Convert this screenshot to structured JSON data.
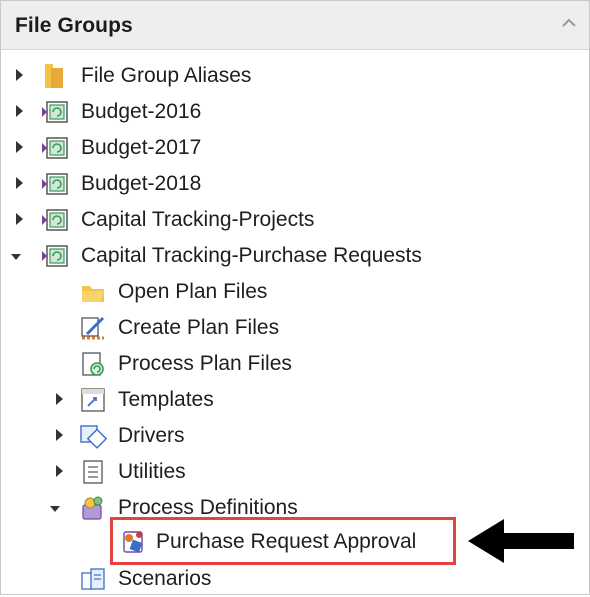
{
  "panel": {
    "title": "File Groups"
  },
  "tree": {
    "file_group_aliases": "File Group Aliases",
    "budget_2016": "Budget-2016",
    "budget_2017": "Budget-2017",
    "budget_2018": "Budget-2018",
    "capital_projects": "Capital Tracking-Projects",
    "capital_purchase": "Capital Tracking-Purchase Requests",
    "open_plan_files": "Open Plan Files",
    "create_plan_files": "Create Plan Files",
    "process_plan_files": "Process Plan Files",
    "templates": "Templates",
    "drivers": "Drivers",
    "utilities": "Utilities",
    "process_definitions": "Process Definitions",
    "purchase_request_approval": "Purchase Request Approval",
    "scenarios": "Scenarios"
  },
  "colors": {
    "highlight_border": "#e5433f",
    "header_bg": "#eeeeee",
    "folder_yellow": "#f2c44a",
    "filegroup_green": "#3a9a5a",
    "filegroup_purple": "#7b3fa0"
  },
  "icons": {
    "expand": "triangle-right-icon",
    "collapse": "triangle-down-icon",
    "folder": "folder-icon",
    "file_group": "file-group-icon",
    "arrow": "left-arrow-icon"
  }
}
